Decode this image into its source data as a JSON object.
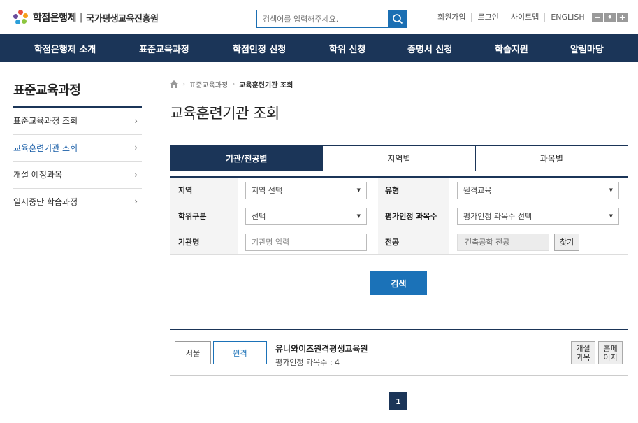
{
  "header": {
    "logo_text": "학점은행제",
    "logo_sub": "국가평생교육진흥원",
    "search_placeholder": "검색어를 입력해주세요.",
    "util_links": [
      "회원가입",
      "로그인",
      "사이트맵",
      "ENGLISH"
    ],
    "zoom": [
      "−",
      "•",
      "+"
    ]
  },
  "nav": {
    "items": [
      "학점은행제 소개",
      "표준교육과정",
      "학점인정 신청",
      "학위 신청",
      "증명서 신청",
      "학습지원",
      "알림마당"
    ]
  },
  "sidebar": {
    "title": "표준교육과정",
    "items": [
      {
        "label": "표준교육과정 조회",
        "active": false
      },
      {
        "label": "교육훈련기관 조회",
        "active": true
      },
      {
        "label": "개설 예정과목",
        "active": false
      },
      {
        "label": "일시중단 학습과정",
        "active": false
      }
    ]
  },
  "breadcrumb": {
    "items": [
      "표준교육과정",
      "교육훈련기관 조회"
    ]
  },
  "main": {
    "title": "교육훈련기관 조회",
    "tabs": [
      {
        "label": "기관/전공별",
        "active": true
      },
      {
        "label": "지역별",
        "active": false
      },
      {
        "label": "과목별",
        "active": false
      }
    ],
    "form": {
      "region_label": "지역",
      "region_value": "지역 선택",
      "type_label": "유형",
      "type_value": "원격교육",
      "degree_label": "학위구분",
      "degree_value": "선택",
      "eval_label": "평가인정 과목수",
      "eval_value": "평가인정 과목수 선택",
      "inst_label": "기관명",
      "inst_placeholder": "기관명 입력",
      "major_label": "전공",
      "major_value": "건축공학 전공",
      "find_label": "찾기"
    },
    "search_label": "검색",
    "result": {
      "region": "서울",
      "type": "원격",
      "name": "유니와이즈원격평생교육원",
      "count": "평가인정 과목수 : 4",
      "btn_courses": "개설\n과목",
      "btn_homepage": "홈페\n이지"
    },
    "page": "1"
  },
  "colors": {
    "navy": "#1b3558",
    "blue": "#1b72b8",
    "logo_petals": [
      "#e94e3c",
      "#f6a01a",
      "#8dc63f",
      "#2c9fd9",
      "#6a4c9c"
    ]
  }
}
